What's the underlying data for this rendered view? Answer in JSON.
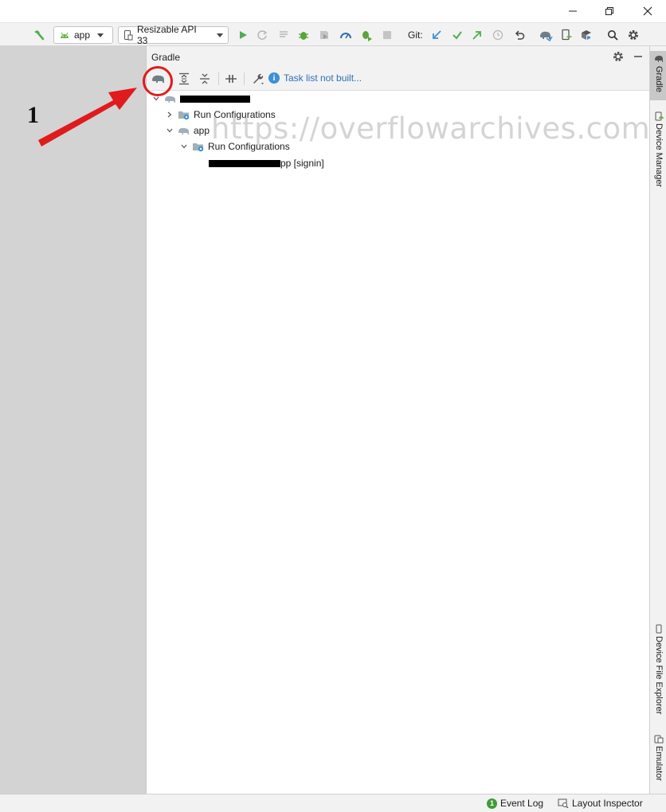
{
  "toolbar": {
    "module_combo": {
      "value": "app",
      "icon": "android-icon"
    },
    "device_combo": {
      "value": "Resizable API 33",
      "icon": "device-icon"
    },
    "git_label": "Git:"
  },
  "gradle": {
    "title": "Gradle",
    "task_info": "Task list not built..."
  },
  "tree": {
    "run_configurations_1": "Run Configurations",
    "app": "app",
    "run_configurations_2": "Run Configurations",
    "signin_config_suffix": "pp [signin]"
  },
  "right_tabs": {
    "gradle": "Gradle",
    "device_manager": "Device Manager",
    "device_file_explorer": "Device File Explorer",
    "emulator": "Emulator"
  },
  "status": {
    "event_log": "Event Log",
    "event_log_count": "1",
    "layout_inspector": "Layout Inspector"
  },
  "watermark": "https://overflowarchives.com",
  "annotation": {
    "number": "1"
  },
  "colors": {
    "accent_blue": "#2f6fb5",
    "run_green": "#4caf50",
    "annotation_red": "#e01b1b",
    "gradle_icon_gray": "#8a9aa3"
  }
}
